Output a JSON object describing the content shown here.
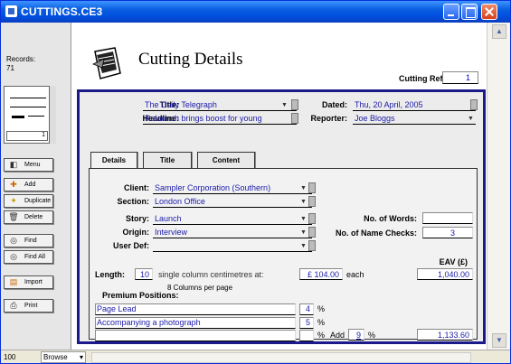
{
  "window": {
    "title": "CUTTINGS.CE3"
  },
  "sidebar": {
    "records_label": "Records:",
    "records_count": "71",
    "book_page": "1",
    "buttons": [
      {
        "label": "Menu",
        "icon": "menu-icon"
      },
      {
        "label": "Add",
        "icon": "add-icon"
      },
      {
        "label": "Duplicate",
        "icon": "duplicate-icon"
      },
      {
        "label": "Delete",
        "icon": "delete-icon"
      },
      {
        "label": "Find",
        "icon": "find-icon"
      },
      {
        "label": "Find All",
        "icon": "find-all-icon"
      },
      {
        "label": "Import",
        "icon": "import-icon"
      },
      {
        "label": "Print",
        "icon": "print-icon"
      }
    ]
  },
  "header": {
    "title": "Cutting Details",
    "ref_label": "Cutting Ref:",
    "ref_value": "1"
  },
  "top_fields": {
    "title_label": "Title:",
    "title_value": "The Daily Telegraph",
    "dated_label": "Dated:",
    "dated_value": "Thu, 20 April, 2005",
    "headline_label": "Headline:",
    "headline_value": "Relaunch brings boost for young",
    "reporter_label": "Reporter:",
    "reporter_value": "Joe Bloggs"
  },
  "tabs": [
    {
      "label": "Details",
      "active": true
    },
    {
      "label": "Title",
      "active": false
    },
    {
      "label": "Content",
      "active": false
    }
  ],
  "details": {
    "client_label": "Client:",
    "client_value": "Sampler Corporation (Southern)",
    "section_label": "Section:",
    "section_value": "London Office",
    "story_label": "Story:",
    "story_value": "Launch",
    "origin_label": "Origin:",
    "origin_value": "Interview",
    "userdef_label": "User Def:",
    "userdef_value": "",
    "words_label": "No. of Words:",
    "words_value": "",
    "checks_label": "No. of Name Checks:",
    "checks_value": "3",
    "eav_label": "EAV (£)",
    "length_label": "Length:",
    "length_value": "10",
    "length_unit": "single column centimetres at:",
    "rate_value": "£ 104.00",
    "each_label": "each",
    "eav_value": "1,040.00",
    "premium_label": "Premium Positions:",
    "columns_note": "8 Columns per page",
    "positions": [
      {
        "name": "Page Lead",
        "pct": "4"
      },
      {
        "name": "Accompanying a photograph",
        "pct": "5"
      },
      {
        "name": "",
        "pct": ""
      }
    ],
    "pct_sign": "%",
    "add_label": "Add",
    "add_value": "9",
    "total_value": "1,133.60"
  },
  "statusbar": {
    "zoom": "100",
    "mode": "Browse"
  },
  "colors": {
    "titlebar": "#0a5ee0",
    "panel_border": "#1a1a8a",
    "field_text": "#1a1aa8"
  }
}
